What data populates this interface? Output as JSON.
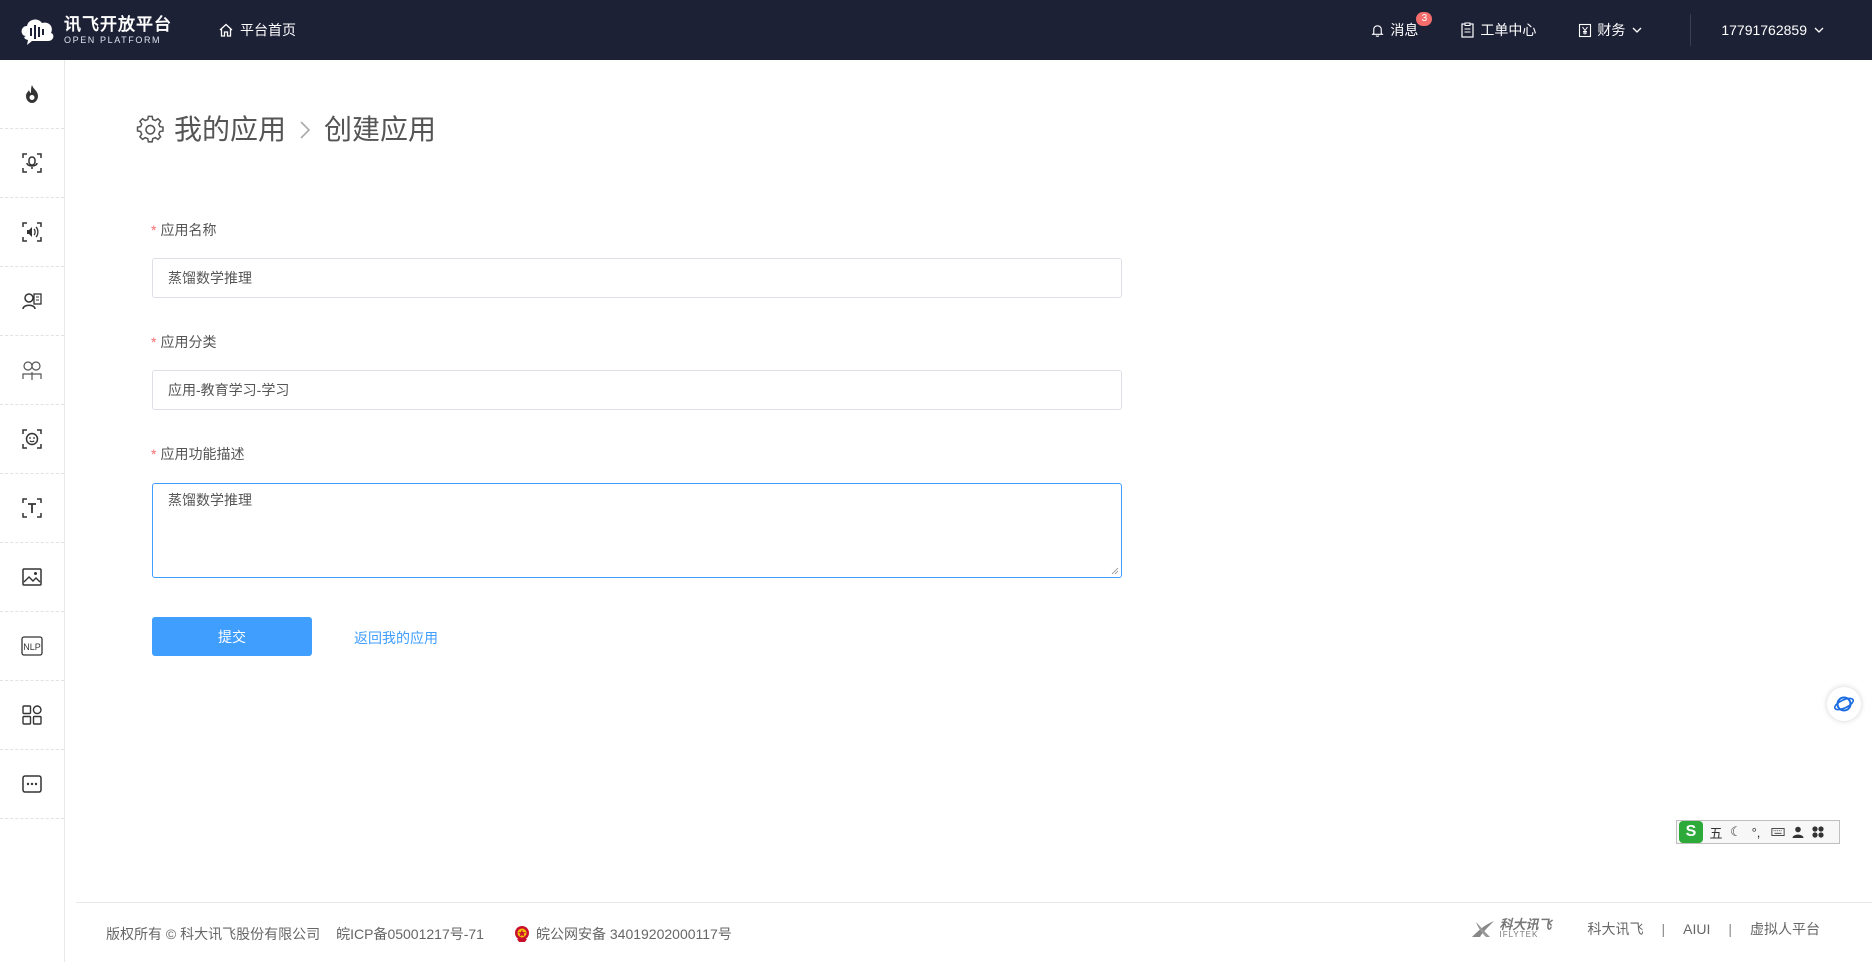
{
  "header": {
    "logo_cn": "讯飞开放平台",
    "logo_en": "OPEN PLATFORM",
    "home_label": "平台首页",
    "messages_label": "消息",
    "messages_count": "3",
    "tickets_label": "工单中心",
    "finance_label": "财务",
    "user_label": "17791762859"
  },
  "sidebar": {
    "items": [
      {
        "icon": "fire-icon"
      },
      {
        "icon": "speech-recognition-icon"
      },
      {
        "icon": "speech-synthesis-icon"
      },
      {
        "icon": "voice-assistant-icon"
      },
      {
        "icon": "face-compare-icon"
      },
      {
        "icon": "face-scan-icon"
      },
      {
        "icon": "text-recognition-icon"
      },
      {
        "icon": "image-icon"
      },
      {
        "icon": "nlp-icon"
      },
      {
        "icon": "apps-grid-icon"
      },
      {
        "icon": "more-icon"
      }
    ]
  },
  "breadcrumb": {
    "root": "我的应用",
    "current": "创建应用"
  },
  "form": {
    "required_mark": "*",
    "name_label": "应用名称",
    "name_value": "蒸馏数学推理",
    "category_label": "应用分类",
    "category_value": "应用-教育学习-学习",
    "desc_label": "应用功能描述",
    "desc_value": "蒸馏数学推理",
    "submit_label": "提交",
    "back_label": "返回我的应用"
  },
  "ime": {
    "logo": "S",
    "mode": "五",
    "moon": "☾",
    "punct": "°,"
  },
  "footer": {
    "copyright": "版权所有 © 科大讯飞股份有限公司",
    "icp": "皖ICP备05001217号-71",
    "police": "皖公网安备 34019202000117号",
    "brand_cn": "科大讯飞",
    "brand_en": "IFLYTEK",
    "links": [
      "科大讯飞",
      "AIUI",
      "虚拟人平台"
    ],
    "separator": "|"
  },
  "colors": {
    "topbar_bg": "#1d2136",
    "primary": "#409eff",
    "required": "#f56c6c"
  }
}
